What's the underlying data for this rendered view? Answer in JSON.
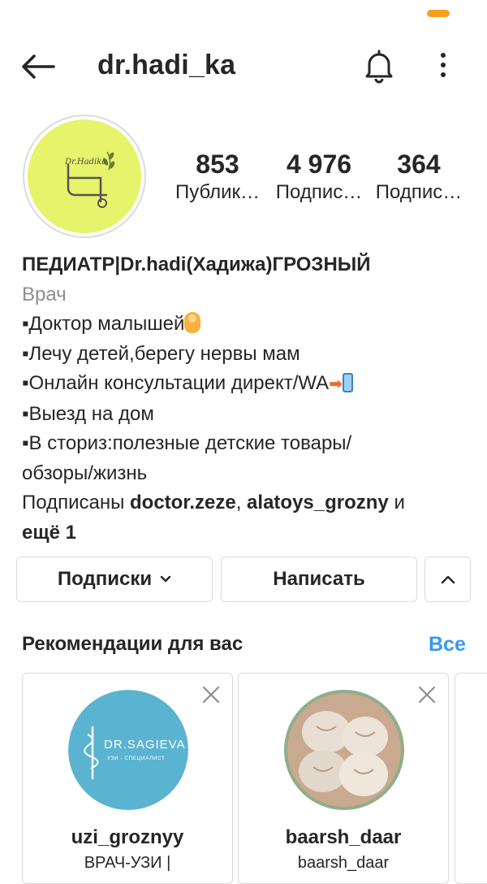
{
  "colors": {
    "accent_blue": "#3897f0",
    "status_orange": "#f7a01e",
    "avatar_bg": "#e5f46a",
    "card1_avatar": "#5ab3d0",
    "text_primary": "#262626",
    "text_secondary": "#8e8e8e"
  },
  "header": {
    "username": "dr.hadi_ka",
    "back_icon": "arrow-left-icon",
    "bell_icon": "bell-icon",
    "more_icon": "more-vertical-icon"
  },
  "profile": {
    "avatar_logo_text": "Dr.Hadika",
    "stats": {
      "posts": {
        "count": "853",
        "label": "Публик…"
      },
      "followers": {
        "count": "4 976",
        "label": "Подпис…"
      },
      "following": {
        "count": "364",
        "label": "Подпис…"
      }
    },
    "bio": {
      "name": "ПЕДИАТР|Dr.hadi(Хадижа)ГРОЗНЫЙ",
      "category": "Врач",
      "line1": "▪Доктор малышей",
      "line2": "▪Лечу детей,берегу нервы мам",
      "line3": "▪Онлайн консультации директ/WA",
      "line4": "▪Выезд на дом",
      "line5a": "▪В сториз:полезные детские товары/",
      "line5b": "обзоры/жизнь",
      "followed_prefix": "Подписаны ",
      "followed_user1": "doctor.zeze",
      "followed_sep": ", ",
      "followed_user2": "alatoys_grozny",
      "followed_and": " и",
      "followed_more": "ещё 1"
    }
  },
  "actions": {
    "following_label": "Подписки",
    "message_label": "Написать"
  },
  "suggestions": {
    "title": "Рекомендации для вас",
    "see_all": "Все",
    "cards": [
      {
        "username": "uzi_groznyy",
        "subtitle": "ВРАЧ-УЗИ |",
        "avatar_text": "DR.SAGIEVA",
        "avatar_subtext": "УЗИ - СПЕЦИАЛИСТ"
      },
      {
        "username": "baarsh_daar",
        "subtitle": "baarsh_daar"
      },
      {
        "username": "",
        "subtitle": ""
      }
    ]
  }
}
